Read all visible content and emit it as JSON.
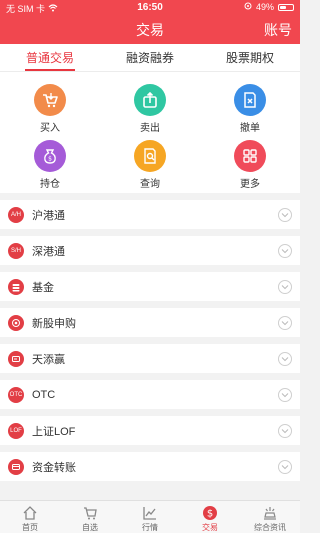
{
  "status_bar": {
    "carrier": "无 SIM 卡",
    "time": "16:50",
    "battery_pct": "49%"
  },
  "nav": {
    "title": "交易",
    "right_label": "账号"
  },
  "tabs": [
    {
      "label": "普通交易"
    },
    {
      "label": "融资融券"
    },
    {
      "label": "股票期权"
    }
  ],
  "grid": [
    {
      "label": "买入",
      "color": "#f28b4a",
      "icon": "cart-icon"
    },
    {
      "label": "卖出",
      "color": "#2fc7a2",
      "icon": "bag-out-icon"
    },
    {
      "label": "撤单",
      "color": "#3a8ee6",
      "icon": "cancel-doc-icon"
    },
    {
      "label": "持仓",
      "color": "#a55bd8",
      "icon": "money-bag-icon"
    },
    {
      "label": "查询",
      "color": "#f6a623",
      "icon": "search-doc-icon"
    },
    {
      "label": "更多",
      "color": "#f04b5a",
      "icon": "grid-icon"
    }
  ],
  "list": [
    {
      "label": "沪港通",
      "badge": "A/H"
    },
    {
      "label": "深港通",
      "badge": "S/H"
    },
    {
      "label": "基金",
      "badge": ""
    },
    {
      "label": "新股申购",
      "badge": ""
    },
    {
      "label": "天添赢",
      "badge": ""
    },
    {
      "label": "OTC",
      "badge": "OTC"
    },
    {
      "label": "上证LOF",
      "badge": "LOF"
    },
    {
      "label": "资金转账",
      "badge": ""
    }
  ],
  "bottom_tabs": [
    {
      "label": "首页"
    },
    {
      "label": "自选"
    },
    {
      "label": "行情"
    },
    {
      "label": "交易"
    },
    {
      "label": "综合资讯"
    }
  ],
  "colors": {
    "brand_red": "#f1474f",
    "accent": "#e23e45"
  }
}
